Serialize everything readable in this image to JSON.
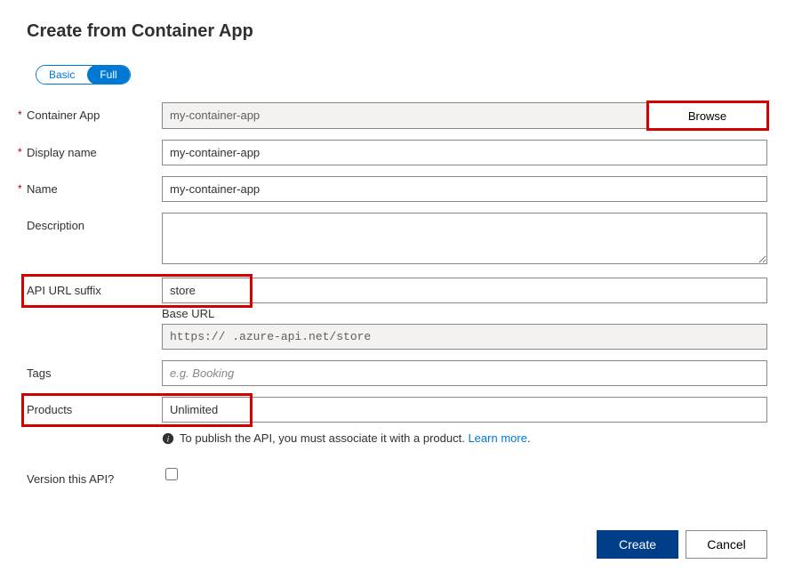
{
  "title": "Create from Container App",
  "toggle": {
    "basic": "Basic",
    "full": "Full"
  },
  "labels": {
    "containerApp": "Container App",
    "displayName": "Display name",
    "name": "Name",
    "description": "Description",
    "apiUrlSuffix": "API URL suffix",
    "baseUrl": "Base URL",
    "tags": "Tags",
    "products": "Products",
    "versionThisApi": "Version this API?"
  },
  "values": {
    "containerApp": "my-container-app",
    "displayName": "my-container-app",
    "name": "my-container-app",
    "description": "",
    "apiUrlSuffix": "store",
    "baseUrl": "https://             .azure-api.net/store",
    "tags": "",
    "products": "Unlimited"
  },
  "placeholders": {
    "tags": "e.g. Booking"
  },
  "buttons": {
    "browse": "Browse",
    "create": "Create",
    "cancel": "Cancel"
  },
  "info": {
    "text": "To publish the API, you must associate it with a product. ",
    "link": "Learn more"
  }
}
